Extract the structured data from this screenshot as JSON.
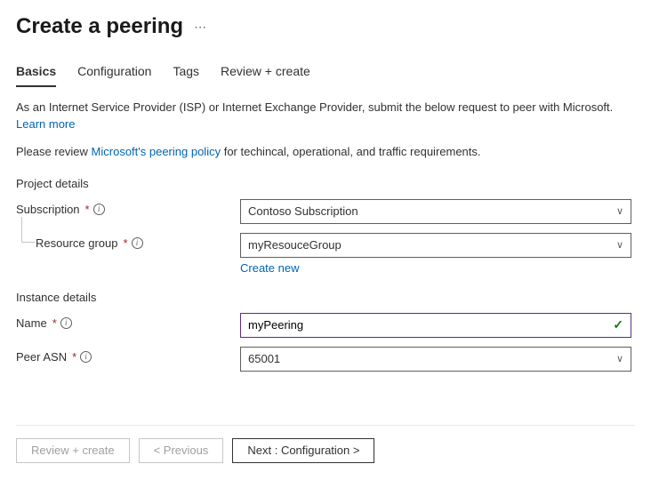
{
  "header": {
    "title": "Create a peering"
  },
  "tabs": [
    {
      "label": "Basics",
      "active": true
    },
    {
      "label": "Configuration",
      "active": false
    },
    {
      "label": "Tags",
      "active": false
    },
    {
      "label": "Review + create",
      "active": false
    }
  ],
  "intro": {
    "text": "As an Internet Service Provider (ISP) or Internet Exchange Provider, submit the below request to peer with Microsoft.",
    "learn_more": "Learn more",
    "policy_pre": "Please review ",
    "policy_link": "Microsoft's peering policy",
    "policy_post": " for techincal, operational, and traffic requirements."
  },
  "sections": {
    "project": {
      "title": "Project details",
      "subscription": {
        "label": "Subscription",
        "value": "Contoso Subscription"
      },
      "resource_group": {
        "label": "Resource group",
        "value": "myResouceGroup",
        "create_new": "Create new"
      }
    },
    "instance": {
      "title": "Instance details",
      "name": {
        "label": "Name",
        "value": "myPeering"
      },
      "peer_asn": {
        "label": "Peer ASN",
        "value": "65001"
      }
    }
  },
  "footer": {
    "review_create": "Review + create",
    "previous": "< Previous",
    "next": "Next : Configuration >"
  }
}
